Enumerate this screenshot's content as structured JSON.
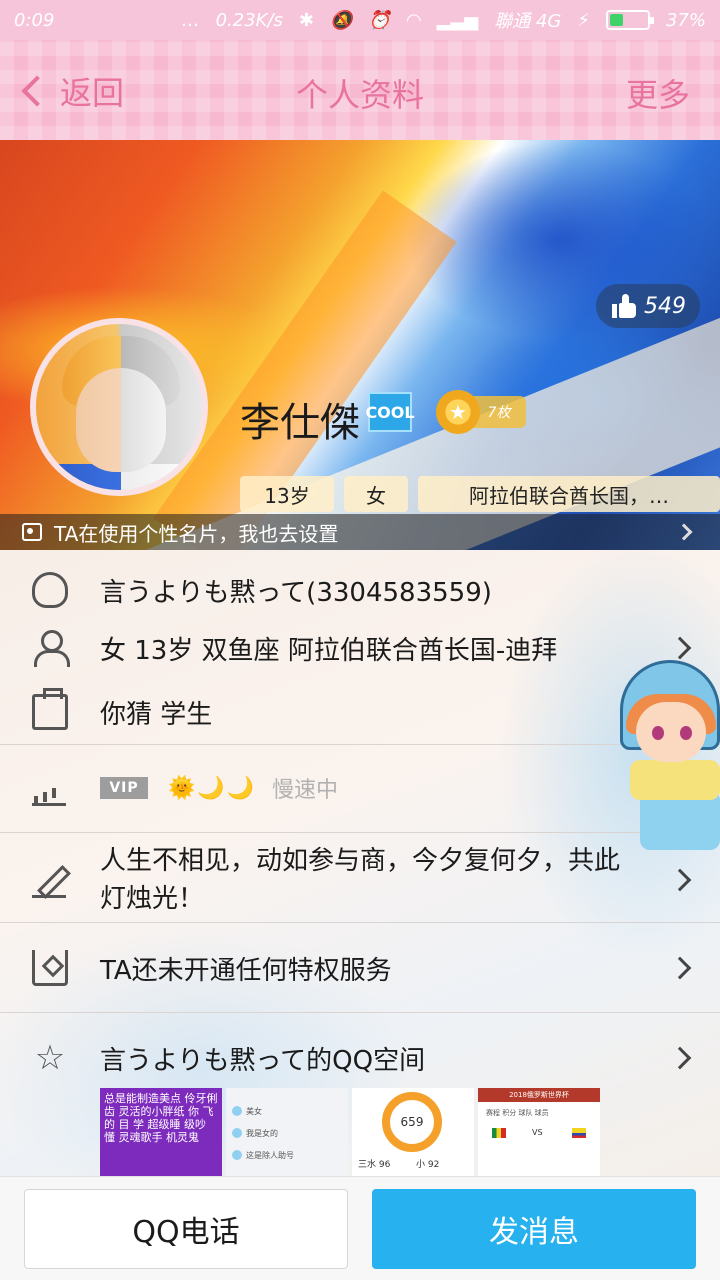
{
  "status_bar": {
    "time": "0:09",
    "dots": "…",
    "speed": "0.23K/s",
    "bluetooth": "✱",
    "mute": "🔕",
    "alarm": "⏰",
    "wifi": "◠",
    "signal": "▂▃▅",
    "carrier": "聯通 4G",
    "charging": "⚡",
    "battery_percent": "37%",
    "battery_level": 0.37
  },
  "nav": {
    "back_label": "返回",
    "title": "个人资料",
    "more_label": "更多"
  },
  "profile": {
    "nickname": "李仕傑",
    "cool_badge": "COOL",
    "medal_star": "★",
    "medal_count": "7枚",
    "likes": "549",
    "tags": [
      "13岁",
      "女",
      "阿拉伯联合酋长国，…"
    ],
    "card_prompt": "TA在使用个性名片，我也去设置"
  },
  "info_rows": {
    "qq": "言うよりも黙って(3304583559)",
    "basic": "女 13岁 双鱼座 阿拉伯联合酋长国-迪拜",
    "job": "你猜 学生",
    "vip_badge": "VIP",
    "level_icons": "🌞🌙🌙",
    "level_status": "慢速中",
    "signature": "人生不相见，动如参与商，今夕复何夕，共此灯烛光！",
    "privilege": "TA还未开通任何特权服务",
    "qzone": "言うよりも黙って的QQ空间",
    "star_icon": "☆"
  },
  "gallery": {
    "g1_text": "总是能制造美点 伶牙俐齿 灵活的小胖纸 你 飞 的 目 学 超级睡 级吵 懂 灵魂歌手 机灵鬼",
    "g2_lines": [
      "美女",
      "我是女的",
      "这是除人助号"
    ],
    "g3_value": "659",
    "g3_left": "三水 96",
    "g3_right": "小 92",
    "g4_header": "2018俄罗斯世界杯",
    "g4_tabs": "赛程 积分 球队 球员",
    "g4_vs": "VS"
  },
  "bottom": {
    "call_label": "QQ电话",
    "message_label": "发消息"
  },
  "colors": {
    "nav_pink": "#f6b9d0",
    "nav_text": "#e9739f",
    "message_button": "#27b1ee"
  }
}
